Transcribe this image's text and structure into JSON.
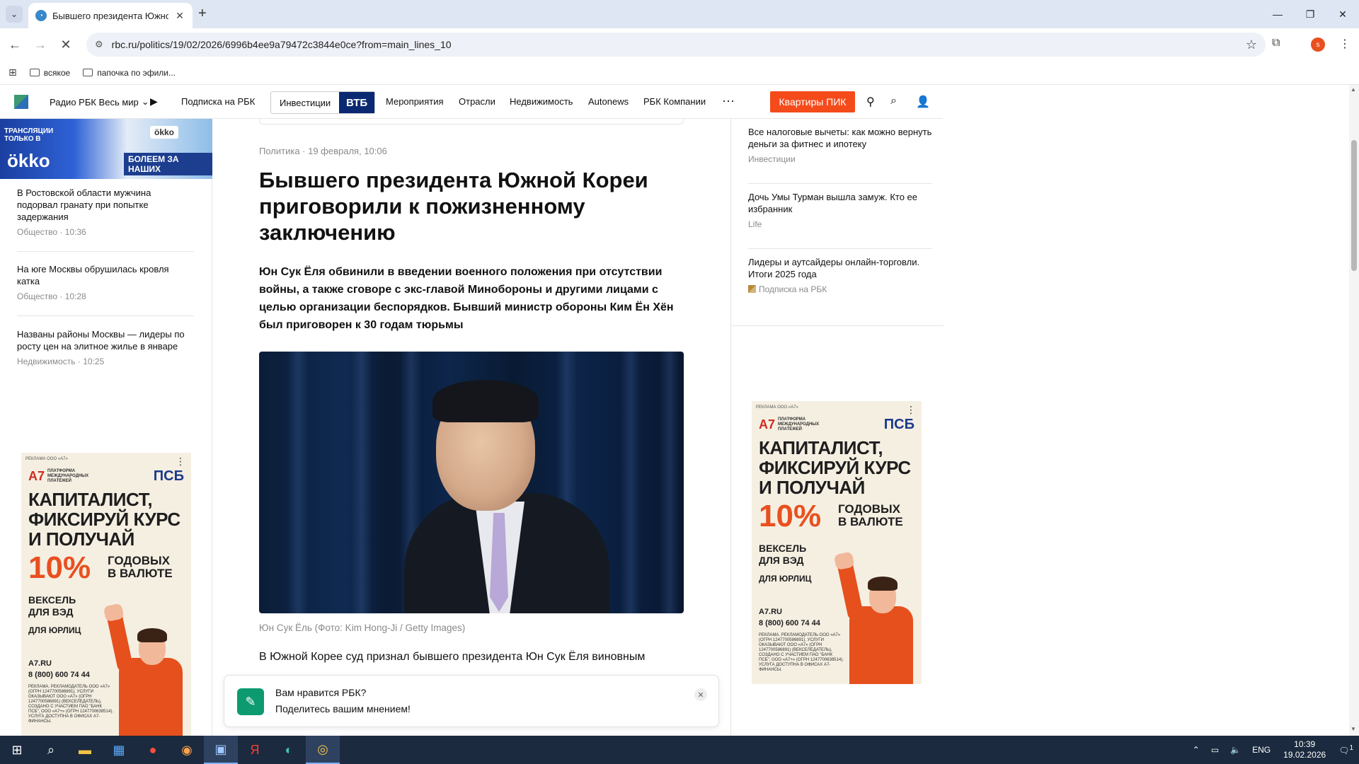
{
  "browser": {
    "tab_title": "Бывшего президента Южной",
    "url": "rbc.ru/politics/19/02/2026/6996b4ee9a79472c3844e0ce?from=main_lines_10",
    "bookmarks": [
      "всякое",
      "папочка по эфили..."
    ],
    "profile_initial": "s"
  },
  "header": {
    "radio_label": "Радио РБК Весь мир",
    "links": [
      "Подписка на РБК",
      "Мероприятия",
      "Отрасли",
      "Недвижимость",
      "Autonews",
      "РБК Компании"
    ],
    "investments_label": "Инвестиции",
    "vtb_label": "ВТБ",
    "pik_button": "Квартиры ПИК"
  },
  "left_banner": {
    "top_text": "ТРАНСЛЯЦИИ ТОЛЬКО В",
    "brand": "ökko",
    "badge": "ökko",
    "slogan": "БОЛЕЕМ ЗА НАШИХ"
  },
  "left_news": [
    {
      "title": "В Ростовской области мужчина подорвал гранату при попытке задержания",
      "meta": "Общество · 10:36"
    },
    {
      "title": "На юге Москвы обрушилась кровля катка",
      "meta": "Общество · 10:28"
    },
    {
      "title": "Названы районы Москвы — лидеры по росту цен на элитное жилье в январе",
      "meta": "Недвижимость · 10:25"
    }
  ],
  "article": {
    "meta": "Политика · 19 февраля, 10:06",
    "title": "Бывшего президента Южной Кореи приговорили к пожизненному заключению",
    "lead": "Юн Сук Ёля обвинили в введении военного положения при отсутствии войны, а также сговоре с экс-главой Минобороны и другими лицами с целью организации беспорядков. Бывший министр обороны Ким Ён Хён был приговорен к 30 годам тюрьмы",
    "caption": "Юн Сук Ёль (Фото: Kim Hong-Ji / Getty Images)",
    "body_first_line": "В Южной Корее суд признал бывшего президента Юн Сук Ёля виновным"
  },
  "feedback": {
    "title": "Вам нравится РБК?",
    "subtitle": "Поделитесь вашим мнением!"
  },
  "right_news": [
    {
      "title": "Все налоговые вычеты: как можно вернуть деньги за фитнес и ипотеку",
      "meta": "Инвестиции"
    },
    {
      "title": "Дочь Умы Турман вышла замуж. Кто ее избранник",
      "meta": "Life"
    },
    {
      "title": "Лидеры и аутсайдеры онлайн-торговли. Итоги 2025 года",
      "meta": "Подписка на РБК"
    }
  ],
  "ad": {
    "tiny": "РЕКЛАМА ООО «А7»",
    "a7_label": "А7",
    "a7_sub": "ПЛАТФОРМА МЕЖДУНАРОДНЫХ ПЛАТЕЖЕЙ",
    "psb_label": "ПСБ",
    "headline": "КАПИТАЛИСТ, ФИКСИРУЙ КУРС И ПОЛУЧАЙ",
    "percent": "10%",
    "percent_tail": "ГОДОВЫХ В ВАЛЮТЕ",
    "sub": "ВЕКСЕЛЬ ДЛЯ ВЭД",
    "sub2": "ДЛЯ ЮРЛИЦ",
    "site": "А7.RU",
    "phone": "8 (800) 600 74 44",
    "legal": "РЕКЛАМА. РЕКЛАМОДАТЕЛЬ ООО «А7» (ОГРН 1247700586891). УСЛУГИ ОКАЗЫВАЮТ ООО «А7» (ОГРН 1247700586891) (ВЕКСЕЛЕДАТЕЛЬ), СОЗДАНО С УЧАСТИЕМ ПАО \"БАНК ПСБ\", ООО «А7+» (ОГРН 1247700638514). УСЛУГА ДОСТУПНА В ОФИСАХ А7-ФИНАНСЫ."
  },
  "taskbar": {
    "lang": "ENG",
    "time": "10:39",
    "date": "19.02.2026",
    "notif_count": "1"
  }
}
